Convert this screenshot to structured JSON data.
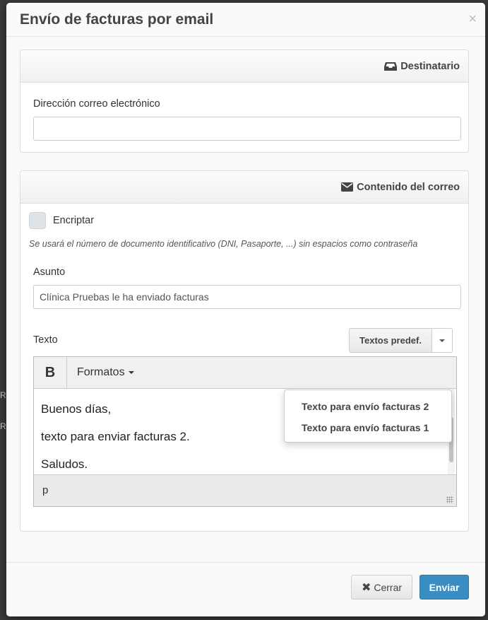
{
  "background": {
    "letters": [
      "R",
      "R"
    ]
  },
  "modal": {
    "title": "Envío de facturas por email",
    "close_symbol": "×"
  },
  "recipient": {
    "heading": "Destinatario",
    "icon": "inbox-icon",
    "email_label": "Dirección correo electrónico",
    "email_value": ""
  },
  "content": {
    "heading": "Contenido del correo",
    "icon": "envelope-icon",
    "encrypt_label": "Encriptar",
    "encrypt_hint": "Se usará el número de documento identificativo (DNI, Pasaporte, ...) sin espacios como contraseña",
    "subject_label": "Asunto",
    "subject_value": "Clínica Pruebas le ha enviado facturas",
    "text_label": "Texto",
    "predef_button": "Textos predef.",
    "predef_options": [
      "Texto para envío facturas 2",
      "Texto para envío facturas 1"
    ]
  },
  "editor": {
    "bold_label": "B",
    "formats_label": "Formatos",
    "paragraphs": [
      "Buenos días,",
      "texto para enviar facturas 2.",
      "Saludos."
    ],
    "status_path": "p"
  },
  "footer": {
    "close_label": "Cerrar",
    "send_label": "Enviar",
    "send_color": "#3a8dc2"
  }
}
